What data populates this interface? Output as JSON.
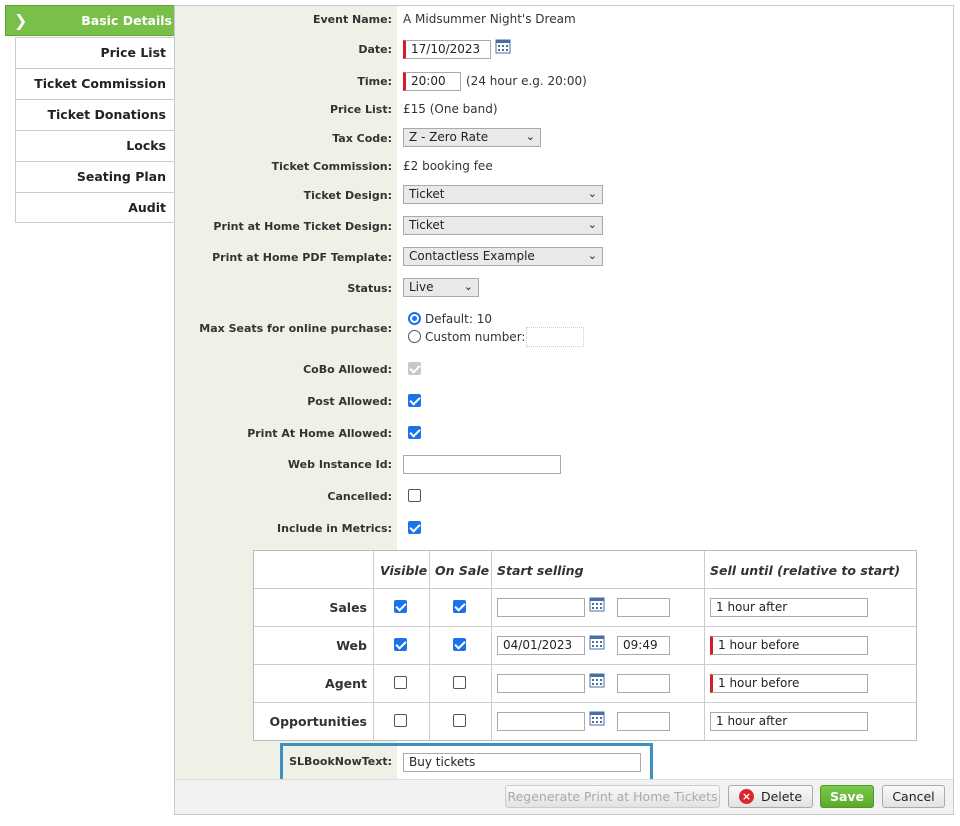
{
  "tabs": [
    {
      "label": "Basic Details"
    },
    {
      "label": "Price List"
    },
    {
      "label": "Ticket Commission"
    },
    {
      "label": "Ticket Donations"
    },
    {
      "label": "Locks"
    },
    {
      "label": "Seating Plan"
    },
    {
      "label": "Audit"
    }
  ],
  "form": {
    "event_name_label": "Event Name:",
    "event_name": "A Midsummer Night's Dream",
    "date_label": "Date:",
    "date": "17/10/2023",
    "time_label": "Time:",
    "time": "20:00",
    "time_hint": "(24 hour e.g. 20:00)",
    "price_list_label": "Price List:",
    "price_list": "£15 (One band)",
    "tax_code_label": "Tax Code:",
    "tax_code": "Z - Zero Rate",
    "ticket_commission_label": "Ticket Commission:",
    "ticket_commission": "£2 booking fee",
    "ticket_design_label": "Ticket Design:",
    "ticket_design": "Ticket",
    "pah_design_label": "Print at Home Ticket Design:",
    "pah_design": "Ticket",
    "pah_pdf_label": "Print at Home PDF Template:",
    "pah_pdf": "Contactless Example",
    "status_label": "Status:",
    "status": "Live",
    "max_seats_label": "Max Seats for online purchase:",
    "max_default": "Default: 10",
    "max_custom": "Custom number:",
    "cobo_label": "CoBo Allowed:",
    "post_label": "Post Allowed:",
    "pah_allowed_label": "Print At Home Allowed:",
    "web_instance_label": "Web Instance Id:",
    "web_instance": "",
    "cancelled_label": "Cancelled:",
    "metrics_label": "Include in Metrics:",
    "slbook_label": "SLBookNowText:",
    "slbook": "Buy tickets"
  },
  "grid": {
    "headers": [
      "Visible",
      "On Sale",
      "Start selling",
      "Sell until (relative to start)"
    ],
    "rows": [
      {
        "name": "Sales",
        "visible": true,
        "on_sale": true,
        "start_date": "",
        "start_time": "",
        "sell_until": "1 hour after",
        "required": false
      },
      {
        "name": "Web",
        "visible": true,
        "on_sale": true,
        "start_date": "04/01/2023",
        "start_time": "09:49",
        "sell_until": "1 hour before",
        "required": true
      },
      {
        "name": "Agent",
        "visible": false,
        "on_sale": false,
        "start_date": "",
        "start_time": "",
        "sell_until": "1 hour before",
        "required": true
      },
      {
        "name": "Opportunities",
        "visible": false,
        "on_sale": false,
        "start_date": "",
        "start_time": "",
        "sell_until": "1 hour after",
        "required": false
      }
    ]
  },
  "buttons": {
    "regenerate": "Regenerate Print at Home Tickets",
    "delete": "Delete",
    "save": "Save",
    "cancel": "Cancel"
  },
  "colors": {
    "accent": "#78c04a",
    "required": "#d21f2b",
    "checkbox": "#1a73e8",
    "highlight": "#3c8fc2"
  }
}
